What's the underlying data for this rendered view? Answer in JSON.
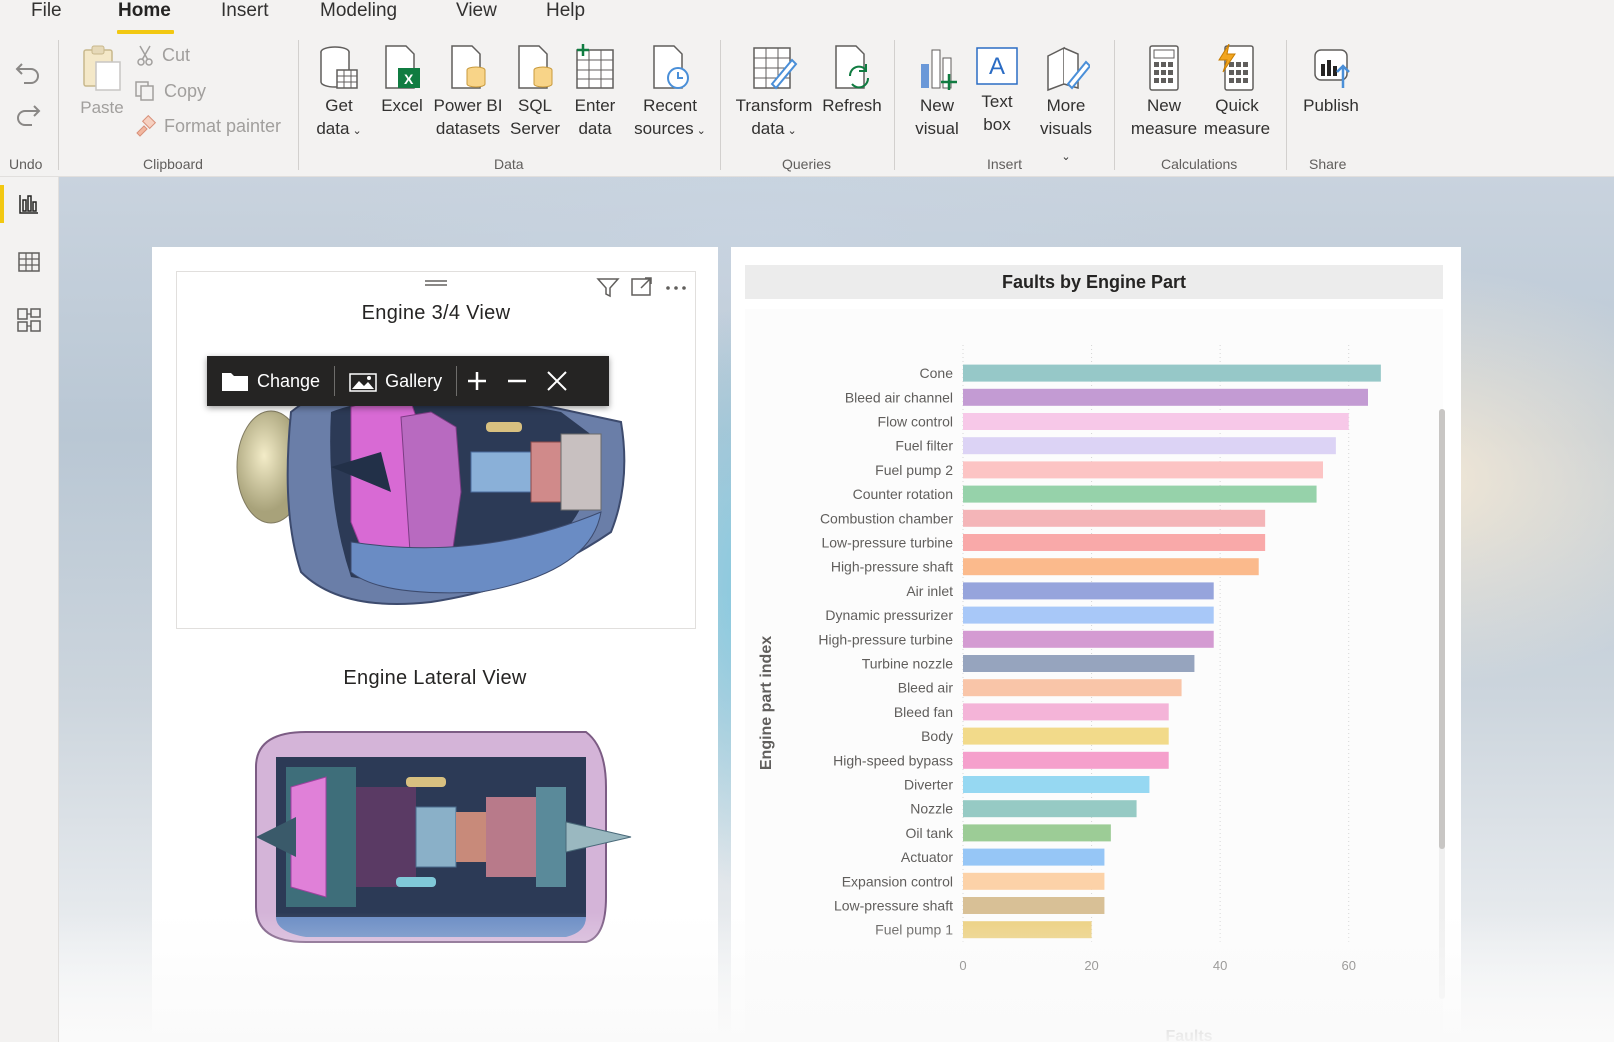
{
  "menu": {
    "items": [
      "File",
      "Home",
      "Insert",
      "Modeling",
      "View",
      "Help"
    ],
    "active": "Home"
  },
  "ribbon": {
    "undo": {
      "label": "Undo"
    },
    "clipboard": {
      "label": "Clipboard",
      "paste": "Paste",
      "cut": "Cut",
      "copy": "Copy",
      "format_painter": "Format painter"
    },
    "data": {
      "label": "Data",
      "get_data": [
        "Get",
        "data"
      ],
      "excel": "Excel",
      "powerbi": [
        "Power BI",
        "datasets"
      ],
      "sql": [
        "SQL",
        "Server"
      ],
      "enter": [
        "Enter",
        "data"
      ],
      "recent": [
        "Recent",
        "sources"
      ]
    },
    "queries": {
      "label": "Queries",
      "transform": [
        "Transform",
        "data"
      ],
      "refresh": "Refresh"
    },
    "insert": {
      "label": "Insert",
      "new_visual": [
        "New",
        "visual"
      ],
      "text_box": [
        "Text",
        "box"
      ],
      "more_visuals": [
        "More",
        "visuals"
      ]
    },
    "calculations": {
      "label": "Calculations",
      "new_measure": [
        "New",
        "measure"
      ],
      "quick_measure": [
        "Quick",
        "measure"
      ]
    },
    "share": {
      "label": "Share",
      "publish": "Publish"
    }
  },
  "left_page": {
    "visual1_title": "Engine 3/4 View",
    "visual2_title": "Engine Lateral View",
    "toolbar": {
      "change": "Change",
      "gallery": "Gallery"
    }
  },
  "chart_data": {
    "type": "bar",
    "orientation": "horizontal",
    "title": "Faults by Engine Part",
    "xlabel": "Faults",
    "ylabel": "Engine part index",
    "xlim": [
      0,
      70
    ],
    "xticks": [
      0,
      20,
      40,
      60
    ],
    "grid": true,
    "categories": [
      "Cone",
      "Bleed air channel",
      "Flow control",
      "Fuel filter",
      "Fuel pump 2",
      "Counter rotation",
      "Combustion chamber",
      "Low-pressure turbine",
      "High-pressure shaft",
      "Air inlet",
      "Dynamic pressurizer",
      "High-pressure turbine",
      "Turbine nozzle",
      "Bleed air",
      "Bleed fan",
      "Body",
      "High-speed bypass",
      "Diverter",
      "Nozzle",
      "Oil tank",
      "Actuator",
      "Expansion control",
      "Low-pressure shaft",
      "Fuel pump 1"
    ],
    "values": [
      65,
      63,
      60,
      58,
      56,
      55,
      47,
      47,
      46,
      39,
      39,
      39,
      36,
      34,
      32,
      32,
      32,
      29,
      27,
      23,
      22,
      22,
      22,
      20
    ],
    "colors": [
      "#96c8c8",
      "#c39bd3",
      "#f7c8e8",
      "#dcd3f5",
      "#fcc4c4",
      "#96d2aa",
      "#f4b5b8",
      "#f9a9a9",
      "#fbba8c",
      "#96a4dc",
      "#a8c8f8",
      "#d49bd2",
      "#96a4be",
      "#f9c5a8",
      "#f4b4d8",
      "#f2da8a",
      "#f5a0cc",
      "#96d8f2",
      "#96cac4",
      "#9ccc96",
      "#96c6f6",
      "#fcd2a8",
      "#d8c096",
      "#ecd080"
    ]
  }
}
